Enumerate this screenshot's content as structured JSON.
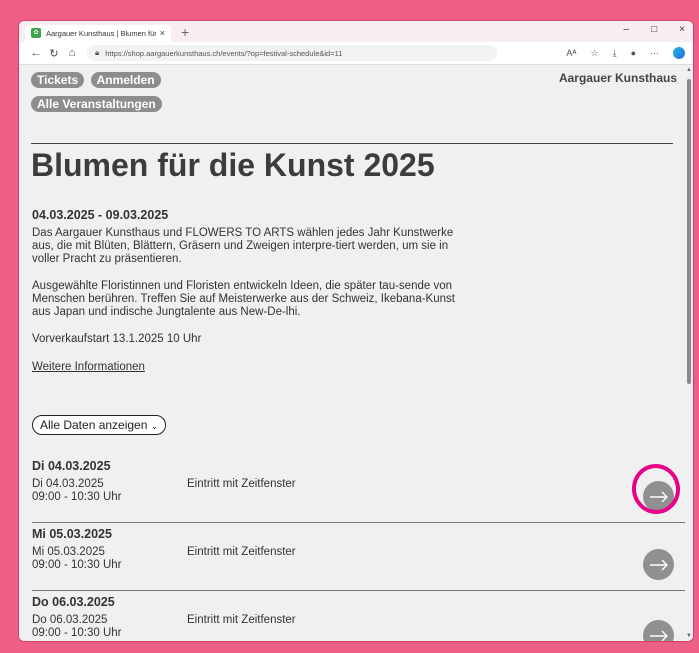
{
  "browser": {
    "tab_title": "Aargauer Kunsthaus | Blumen für",
    "tab_close": "×",
    "new_tab": "+",
    "url": "https://shop.aargauerkunsthaus.ch/events/?op=festival-schedule&id=11",
    "controls": {
      "minimize": "–",
      "maximize": "□",
      "close": "×"
    }
  },
  "site": {
    "nav": [
      "Tickets",
      "Anmelden",
      "Alle Veranstaltungen"
    ],
    "brand": "Aargauer Kunsthaus"
  },
  "event": {
    "title": "Blumen für die Kunst 2025",
    "date_range": "04.03.2025 - 09.03.2025",
    "paragraph1": "Das Aargauer Kunsthaus und FLOWERS TO ARTS wählen jedes Jahr Kunstwerke aus, die mit Blüten, Blättern, Gräsern und Zweigen interpre-tiert werden, um sie in voller Pracht zu präsentieren.",
    "paragraph2": "Ausgewählte Floristinnen und Floristen entwickeln Ideen, die später tau-sende von Menschen berühren. Treffen Sie auf Meisterwerke aus der Schweiz, Ikebana-Kunst aus Japan und indische Jungtalente aus New-De-lhi.",
    "presale": "Vorverkaufstart 13.1.2025 10 Uhr",
    "more_link": "Weitere Informationen",
    "select_value": "Alle Daten anzeigen"
  },
  "days": [
    {
      "heading": "Di 04.03.2025",
      "date": "Di 04.03.2025",
      "time": "09:00 - 10:30 Uhr",
      "type": "Eintritt mit Zeitfenster"
    },
    {
      "heading": "Mi 05.03.2025",
      "date": "Mi 05.03.2025",
      "time": "09:00 - 10:30 Uhr",
      "type": "Eintritt mit Zeitfenster"
    },
    {
      "heading": "Do 06.03.2025",
      "date": "Do 06.03.2025",
      "time": "09:00 - 10:30 Uhr",
      "type": "Eintritt mit Zeitfenster"
    }
  ],
  "colors": {
    "background": "#ee5f86",
    "annotation": "#e6008a",
    "button": "#909090"
  }
}
